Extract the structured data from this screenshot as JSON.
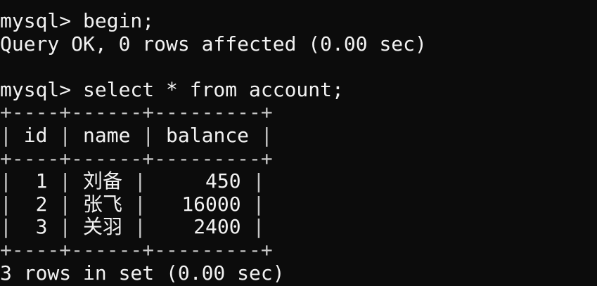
{
  "terminal": {
    "background": "#0c0c0c",
    "foreground": "#f2f2f2",
    "lines": {
      "cmd_begin": "mysql> begin;",
      "resp_begin": "Query OK, 0 rows affected (0.00 sec)",
      "cmd_select": "mysql> select * from account;",
      "border": "+----+------+---------+",
      "footer": "3 rows in set (0.00 sec)"
    },
    "table": {
      "columns": [
        "id",
        "name",
        "balance"
      ],
      "rows": [
        {
          "id": "1",
          "name": "刘备",
          "balance": "450"
        },
        {
          "id": "2",
          "name": "张飞",
          "balance": "16000"
        },
        {
          "id": "3",
          "name": "关羽",
          "balance": "2400"
        }
      ]
    }
  }
}
